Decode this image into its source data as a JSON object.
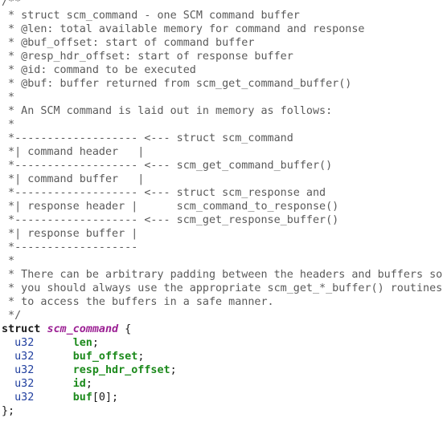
{
  "comment_lines": [
    "/**",
    " * struct scm_command - one SCM command buffer",
    " * @len: total available memory for command and response",
    " * @buf_offset: start of command buffer",
    " * @resp_hdr_offset: start of response buffer",
    " * @id: command to be executed",
    " * @buf: buffer returned from scm_get_command_buffer()",
    " *",
    " * An SCM command is laid out in memory as follows:",
    " *",
    " *------------------- <--- struct scm_command",
    " *| command header   |",
    " *------------------- <--- scm_get_command_buffer()",
    " *| command buffer   |",
    " *------------------- <--- struct scm_response and",
    " *| response header |      scm_command_to_response()",
    " *------------------- <--- scm_get_response_buffer()",
    " *| response buffer |",
    " *-------------------",
    " *",
    " * There can be arbitrary padding between the headers and buffers so",
    " * you should always use the appropriate scm_get_*_buffer() routines",
    " * to access the buffers in a safe manner.",
    " */"
  ],
  "struct_decl": {
    "keyword": "struct",
    "name": "scm_command",
    "open": " {"
  },
  "fields": [
    {
      "type": "u32",
      "pad": "      ",
      "name": "len",
      "suffix": ";"
    },
    {
      "type": "u32",
      "pad": "      ",
      "name": "buf_offset",
      "suffix": ";"
    },
    {
      "type": "u32",
      "pad": "      ",
      "name": "resp_hdr_offset",
      "suffix": ";"
    },
    {
      "type": "u32",
      "pad": "      ",
      "name": "id",
      "suffix": ";"
    },
    {
      "type": "u32",
      "pad": "      ",
      "name": "buf",
      "suffix": "[0];"
    }
  ],
  "indent": "  ",
  "closing": "};"
}
